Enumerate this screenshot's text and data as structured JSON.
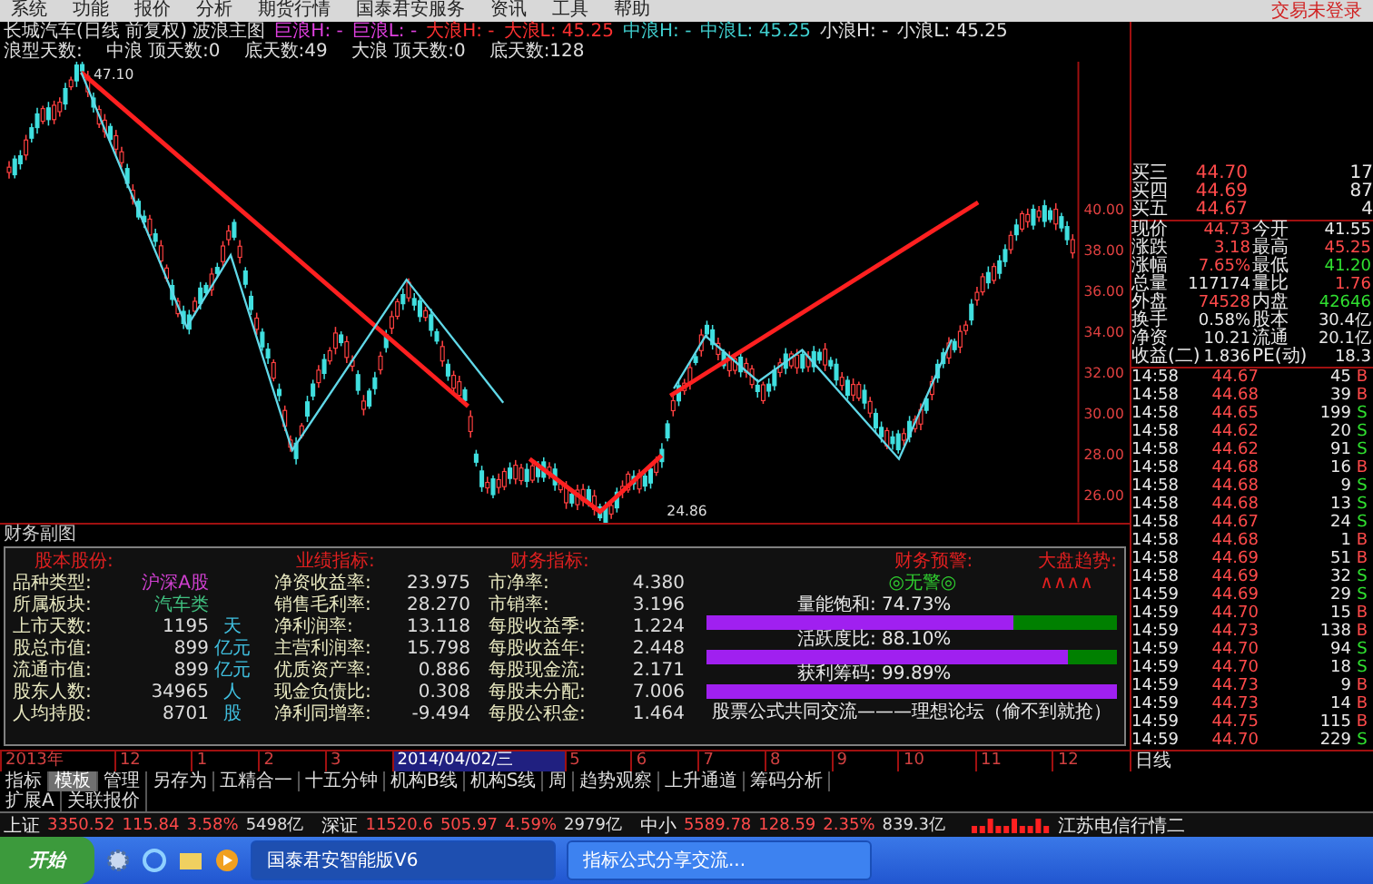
{
  "menu": {
    "items": [
      "系统",
      "功能",
      "报价",
      "分析",
      "期货行情",
      "国泰君安服务",
      "资讯",
      "工具",
      "帮助"
    ],
    "login_status": "交易未登录"
  },
  "chart_header": {
    "title": "长城汽车(日线 前复权) 波浪主图",
    "legend": [
      {
        "label": "巨浪H: -",
        "color": "#e040e0"
      },
      {
        "label": "巨浪L: -",
        "color": "#e040e0"
      },
      {
        "label": "大浪H: -",
        "color": "#ff3030"
      },
      {
        "label": "大浪L: 45.25",
        "color": "#ff3030"
      },
      {
        "label": "中浪H: -",
        "color": "#40d0d0"
      },
      {
        "label": "中浪L: 45.25",
        "color": "#40d0d0"
      },
      {
        "label": "小浪H: -",
        "color": "#e0e0e0"
      },
      {
        "label": "小浪L: 45.25",
        "color": "#e0e0e0"
      }
    ],
    "wave_days": [
      "浪型天数:",
      "中浪 顶天数:0",
      "底天数:49",
      "大浪 顶天数:0",
      "底天数:128"
    ]
  },
  "chart": {
    "price_axis": [
      "40.00",
      "38.00",
      "36.00",
      "34.00",
      "32.00",
      "30.00",
      "28.00",
      "26.00"
    ],
    "high_label": "47.10",
    "low_label": "24.86"
  },
  "finance_panel": {
    "title": "财务副图",
    "sections": [
      {
        "heading": "股本股份:",
        "rows": [
          {
            "label": "品种类型:",
            "value": "沪深A股",
            "color": "#d040d0"
          },
          {
            "label": "所属板块:",
            "value": "汽车类",
            "color": "#40c080"
          },
          {
            "label": "上市天数:",
            "value": "1195",
            "unit": "天"
          },
          {
            "label": "股总市值:",
            "value": "899",
            "unit": "亿元"
          },
          {
            "label": "流通市值:",
            "value": "899",
            "unit": "亿元"
          },
          {
            "label": "股东人数:",
            "value": "34965",
            "unit": "人"
          },
          {
            "label": "人均持股:",
            "value": "8701",
            "unit": "股"
          }
        ]
      },
      {
        "heading": "业绩指标:",
        "rows": [
          {
            "label": "净资收益率:",
            "value": "23.975"
          },
          {
            "label": "销售毛利率:",
            "value": "28.270"
          },
          {
            "label": "净利润率:",
            "value": "13.118"
          },
          {
            "label": "主营利润率:",
            "value": "15.798"
          },
          {
            "label": "优质资产率:",
            "value": "0.886"
          },
          {
            "label": "现金负债比:",
            "value": "0.308"
          },
          {
            "label": "净利同增率:",
            "value": "-9.494"
          }
        ]
      },
      {
        "heading": "财务指标:",
        "rows": [
          {
            "label": "市净率:",
            "value": "4.380"
          },
          {
            "label": "市销率:",
            "value": "3.196"
          },
          {
            "label": "每股收益季:",
            "value": "1.224"
          },
          {
            "label": "每股收益年:",
            "value": "2.448"
          },
          {
            "label": "每股现金流:",
            "value": "2.171"
          },
          {
            "label": "每股未分配:",
            "value": "7.006"
          },
          {
            "label": "每股公积金:",
            "value": "1.464"
          }
        ]
      }
    ],
    "warning": {
      "heading": "财务预警:",
      "value": "◎无警◎"
    },
    "trend": {
      "heading": "大盘趋势:",
      "value": "∧∧∧∧"
    },
    "meters": [
      {
        "label": "量能饱和: 74.73%",
        "level": 0.7473
      },
      {
        "label": "活跃度比: 88.10%",
        "level": 0.881
      },
      {
        "label": "获利筹码: 99.89%",
        "level": 0.9989
      }
    ],
    "footer": "股票公式共同交流———理想论坛（偷不到就抢）"
  },
  "timeline": {
    "labels": [
      {
        "text": "2013年",
        "highlighted": false
      },
      {
        "text": "12",
        "highlighted": false
      },
      {
        "text": "1",
        "highlighted": false
      },
      {
        "text": "2",
        "highlighted": false
      },
      {
        "text": "3",
        "highlighted": false
      },
      {
        "text": "2014/04/02/三",
        "highlighted": true
      },
      {
        "text": "5",
        "highlighted": false
      },
      {
        "text": "6",
        "highlighted": false
      },
      {
        "text": "7",
        "highlighted": false
      },
      {
        "text": "8",
        "highlighted": false
      },
      {
        "text": "9",
        "highlighted": false
      },
      {
        "text": "10",
        "highlighted": false
      },
      {
        "text": "11",
        "highlighted": false
      },
      {
        "text": "12",
        "highlighted": false
      }
    ],
    "period": "日线"
  },
  "quote_panel": {
    "order_book": [
      {
        "label": "买三",
        "price": "44.70",
        "volume": "17"
      },
      {
        "label": "买四",
        "price": "44.69",
        "volume": "87"
      },
      {
        "label": "买五",
        "price": "44.67",
        "volume": "4"
      }
    ],
    "quotes": [
      {
        "label": "现价",
        "value": "44.73",
        "color": "#ff4a4a"
      },
      {
        "label": "今开",
        "value": "41.55",
        "color": "#e8e8e8"
      },
      {
        "label": "涨跌",
        "value": "3.18",
        "color": "#ff4a4a"
      },
      {
        "label": "最高",
        "value": "45.25",
        "color": "#ff4a4a"
      },
      {
        "label": "涨幅",
        "value": "7.65%",
        "color": "#ff4a4a"
      },
      {
        "label": "最低",
        "value": "41.20",
        "color": "#30e030"
      },
      {
        "label": "总量",
        "value": "117174",
        "color": "#e8e8e8"
      },
      {
        "label": "量比",
        "value": "1.76",
        "color": "#ff4a4a"
      },
      {
        "label": "外盘",
        "value": "74528",
        "color": "#ff4a4a"
      },
      {
        "label": "内盘",
        "value": "42646",
        "color": "#30e030"
      },
      {
        "label": "换手",
        "value": "0.58%",
        "color": "#e8e8e8"
      },
      {
        "label": "股本",
        "value": "30.4亿",
        "color": "#e8e8e8"
      },
      {
        "label": "净资",
        "value": "10.21",
        "color": "#e8e8e8"
      },
      {
        "label": "流通",
        "value": "20.1亿",
        "color": "#e8e8e8"
      },
      {
        "label": "收益(二)",
        "value": "1.836",
        "color": "#e8e8e8"
      },
      {
        "label": "PE(动)",
        "value": "18.3",
        "color": "#e8e8e8"
      }
    ],
    "ticks": [
      {
        "time": "14:58",
        "price": "44.67",
        "volume": "45",
        "side": "B",
        "buy": true
      },
      {
        "time": "14:58",
        "price": "44.68",
        "volume": "39",
        "side": "B",
        "buy": true
      },
      {
        "time": "14:58",
        "price": "44.65",
        "volume": "199",
        "side": "S",
        "buy": false
      },
      {
        "time": "14:58",
        "price": "44.62",
        "volume": "20",
        "side": "S",
        "buy": false
      },
      {
        "time": "14:58",
        "price": "44.62",
        "volume": "91",
        "side": "S",
        "buy": false
      },
      {
        "time": "14:58",
        "price": "44.68",
        "volume": "16",
        "side": "B",
        "buy": true
      },
      {
        "time": "14:58",
        "price": "44.68",
        "volume": "9",
        "side": "S",
        "buy": false
      },
      {
        "time": "14:58",
        "price": "44.68",
        "volume": "13",
        "side": "S",
        "buy": false
      },
      {
        "time": "14:58",
        "price": "44.67",
        "volume": "24",
        "side": "S",
        "buy": false
      },
      {
        "time": "14:58",
        "price": "44.68",
        "volume": "1",
        "side": "B",
        "buy": true
      },
      {
        "time": "14:58",
        "price": "44.69",
        "volume": "51",
        "side": "B",
        "buy": true
      },
      {
        "time": "14:58",
        "price": "44.69",
        "volume": "32",
        "side": "S",
        "buy": false
      },
      {
        "time": "14:59",
        "price": "44.69",
        "volume": "29",
        "side": "S",
        "buy": false
      },
      {
        "time": "14:59",
        "price": "44.70",
        "volume": "15",
        "side": "B",
        "buy": true
      },
      {
        "time": "14:59",
        "price": "44.73",
        "volume": "138",
        "side": "B",
        "buy": true
      },
      {
        "time": "14:59",
        "price": "44.70",
        "volume": "94",
        "side": "S",
        "buy": false
      },
      {
        "time": "14:59",
        "price": "44.70",
        "volume": "18",
        "side": "S",
        "buy": false
      },
      {
        "time": "14:59",
        "price": "44.73",
        "volume": "9",
        "side": "B",
        "buy": true
      },
      {
        "time": "14:59",
        "price": "44.73",
        "volume": "14",
        "side": "B",
        "buy": true
      },
      {
        "time": "14:59",
        "price": "44.75",
        "volume": "115",
        "side": "B",
        "buy": true
      },
      {
        "time": "14:59",
        "price": "44.70",
        "volume": "229",
        "side": "S",
        "buy": false
      }
    ]
  },
  "tab_rows": [
    {
      "tabs": [
        {
          "label": "指标",
          "selected": false
        },
        {
          "label": "模板",
          "selected": true
        },
        {
          "label": "管理",
          "selected": false
        },
        {
          "label": "另存为",
          "selected": false
        },
        {
          "label": "五精合一",
          "selected": false
        },
        {
          "label": "十五分钟",
          "selected": false
        },
        {
          "label": "机构B线",
          "selected": false
        },
        {
          "label": "机构S线",
          "selected": false
        },
        {
          "label": "周",
          "selected": false
        },
        {
          "label": "趋势观察",
          "selected": false
        },
        {
          "label": "上升通道",
          "selected": false
        },
        {
          "label": "筹码分析",
          "selected": false
        }
      ]
    },
    {
      "tabs": [
        {
          "label": "扩展A",
          "selected": false
        },
        {
          "label": "关联报价",
          "selected": false
        }
      ]
    }
  ],
  "status_bar": {
    "indices": [
      {
        "name": "上证",
        "value": "3350.52",
        "change": "115.84",
        "percent": "3.58%",
        "turnover": "5498亿"
      },
      {
        "name": "深证",
        "value": "11520.6",
        "change": "505.97",
        "percent": "4.59%",
        "turnover": "2979亿"
      },
      {
        "name": "中小",
        "value": "5589.78",
        "change": "128.59",
        "percent": "2.35%",
        "turnover": "839.3亿"
      }
    ],
    "server": "江苏电信行情二"
  },
  "taskbar": {
    "start": "开始",
    "tasks": [
      {
        "label": "国泰君安智能版V6",
        "selected": true
      },
      {
        "label": "指标公式分享交流...",
        "selected": false
      }
    ]
  }
}
